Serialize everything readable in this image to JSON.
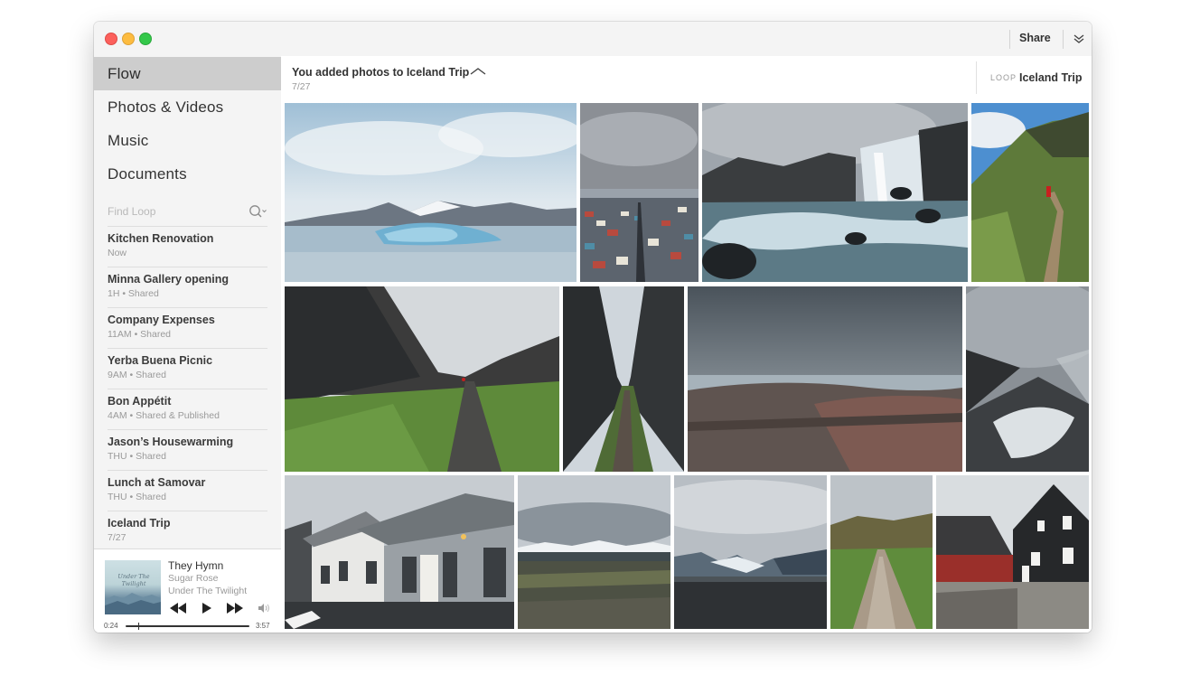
{
  "window": {
    "traffic_lights": [
      "close",
      "minimize",
      "zoom"
    ]
  },
  "sidebar": {
    "nav": [
      {
        "label": "Flow",
        "active": true
      },
      {
        "label": "Photos & Videos",
        "active": false
      },
      {
        "label": "Music",
        "active": false
      },
      {
        "label": "Documents",
        "active": false
      }
    ],
    "search": {
      "placeholder": "Find Loop",
      "value": "",
      "icon": "search-icon"
    },
    "loops": [
      {
        "title": "Kitchen Renovation",
        "meta": "Now"
      },
      {
        "title": "Minna Gallery opening",
        "meta": "1H • Shared"
      },
      {
        "title": "Company Expenses",
        "meta": "11AM • Shared"
      },
      {
        "title": "Yerba Buena Picnic",
        "meta": "9AM • Shared"
      },
      {
        "title": "Bon Appétit",
        "meta": "4AM • Shared & Published"
      },
      {
        "title": "Jason’s Housewarming",
        "meta": "THU • Shared"
      },
      {
        "title": "Lunch at Samovar",
        "meta": "THU • Shared"
      },
      {
        "title": "Iceland Trip",
        "meta": "7/27"
      }
    ]
  },
  "player": {
    "album_text": "Under The Twilight",
    "title": "They Hymn",
    "artist": "Sugar Rose",
    "album": "Under The Twilight",
    "elapsed": "0:24",
    "duration": "3:57",
    "progress": 0.1,
    "controls": [
      "rewind-icon",
      "play-icon",
      "fast-forward-icon",
      "volume-icon"
    ]
  },
  "toolbar": {
    "share_label": "Share",
    "more_icon": "double-chevron-down-icon"
  },
  "header": {
    "title": "You added photos to Iceland Trip",
    "date": "7/27",
    "loop_label": "LOOP",
    "loop_name": "Iceland Trip"
  },
  "colors": {
    "sidebar_bg": "#f4f4f4",
    "sidebar_active": "#cdcdcd",
    "text_primary": "#333333",
    "text_secondary": "#999999",
    "close": "#fc605c",
    "minimize": "#fdbc40",
    "zoom": "#34c84a"
  },
  "photos": [
    "glacier-lagoon",
    "reykjavik-city",
    "waterfall-river",
    "hiker-trail",
    "canyon-path",
    "rock-gorge",
    "stormy-coast",
    "misty-cliff",
    "farm-buildings",
    "mountain-plain",
    "glacier-valley",
    "gravel-road",
    "black-house"
  ]
}
